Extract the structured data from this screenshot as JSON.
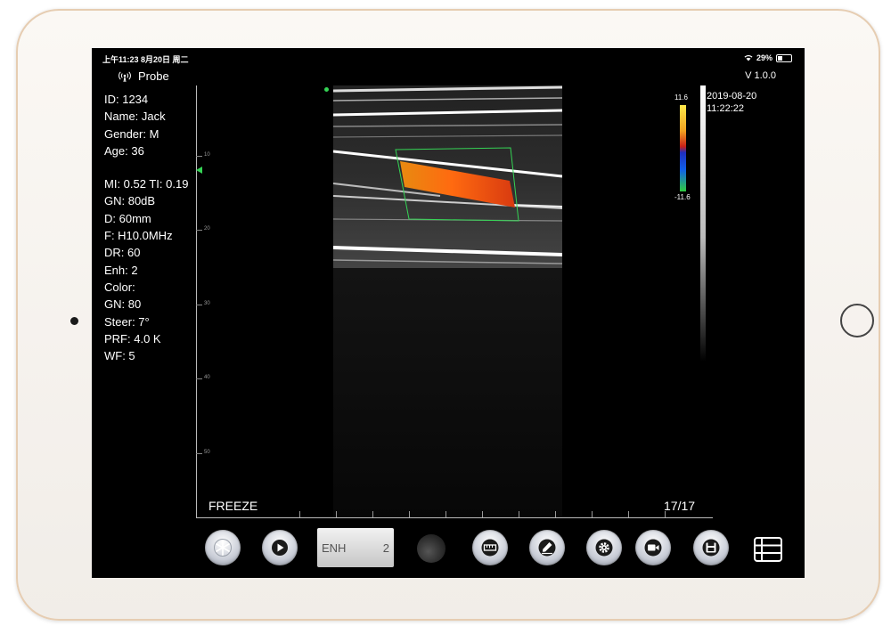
{
  "status": {
    "time_date": "上午11:23  8月20日 周二",
    "battery_pct": "29%"
  },
  "header": {
    "probe_label": "Probe",
    "version": "V 1.0.0"
  },
  "patient": {
    "id": "ID: 1234",
    "name": "Name: Jack",
    "gender": "Gender: M",
    "age": "Age: 36"
  },
  "imaging": {
    "mi_ti": "MI: 0.52 TI: 0.19",
    "gn": "GN: 80dB",
    "depth": "D: 60mm",
    "freq": "F: H10.0MHz",
    "dr": "DR: 60",
    "enh": "Enh: 2",
    "color": "Color:",
    "color_gn": "GN: 80",
    "steer": "Steer: 7°",
    "prf": "PRF: 4.0 K",
    "wf": "WF: 5"
  },
  "depth_scale": {
    "ticks": [
      "10",
      "20",
      "30",
      "40",
      "50"
    ]
  },
  "colorbar": {
    "max": "11.6",
    "min": "-11.6"
  },
  "timestamp": {
    "date": "2019-08-20",
    "time": "11:22:22"
  },
  "footer": {
    "freeze_label": "FREEZE",
    "frame_counter": "17/17"
  },
  "toolbar": {
    "enh_label": "ENH",
    "enh_value": "2"
  },
  "colors": {
    "roi": "#35d455",
    "marker": "#35d455",
    "screen_bg": "#000000"
  },
  "icons": [
    "snowflake-icon",
    "play-icon",
    "dial-icon",
    "ruler-icon",
    "pen-icon",
    "gear-icon",
    "video-camera-icon",
    "save-icon",
    "list-icon"
  ]
}
